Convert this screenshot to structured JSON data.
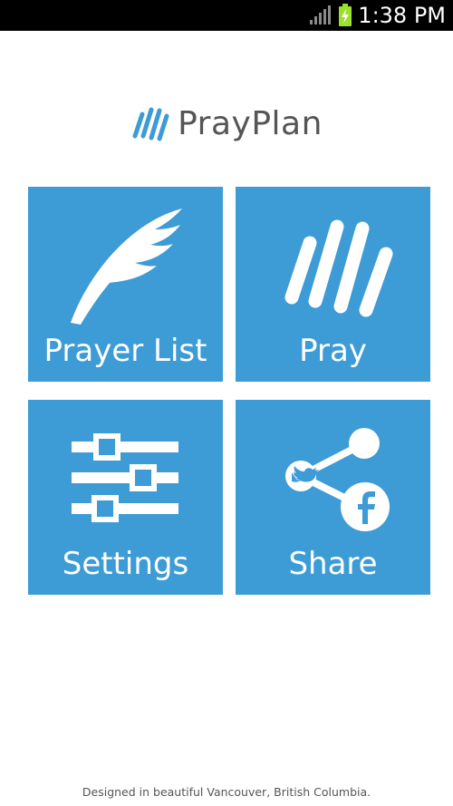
{
  "status_bar": {
    "time": "1:38 PM",
    "signal_icon": "signal-bars-icon",
    "battery_icon": "battery-charging-icon"
  },
  "app": {
    "name": "PrayPlan",
    "logo_icon": "hand-lines-icon",
    "accent": "#3d9bd6"
  },
  "tiles": [
    {
      "label": "Prayer List",
      "icon": "feather-icon"
    },
    {
      "label": "Pray",
      "icon": "hand-icon"
    },
    {
      "label": "Settings",
      "icon": "sliders-icon"
    },
    {
      "label": "Share",
      "icon": "share-icon"
    }
  ],
  "footer": {
    "text": "Designed in beautiful Vancouver, British Columbia."
  }
}
